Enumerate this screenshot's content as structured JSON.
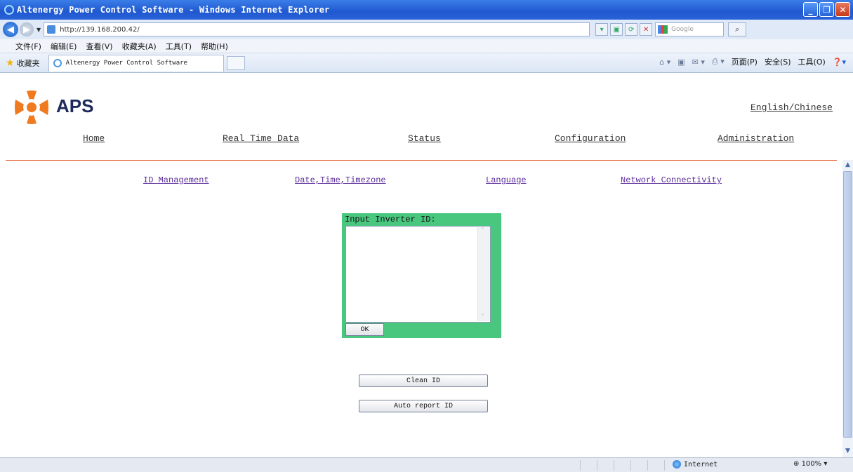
{
  "window": {
    "title": "Altenergy Power Control Software - Windows Internet Explorer"
  },
  "address_bar": {
    "url": "http://139.168.200.42/",
    "search_placeholder": "Google"
  },
  "menu": [
    "文件(F)",
    "编辑(E)",
    "查看(V)",
    "收藏夹(A)",
    "工具(T)",
    "帮助(H)"
  ],
  "favorites": {
    "label": "收藏夹",
    "tab_title": "Altenergy Power Control Software"
  },
  "command_bar": {
    "page": "页面(P)",
    "safety": "安全(S)",
    "tools": "工具(O)"
  },
  "page": {
    "brand": "APS",
    "language_toggle": "English/Chinese",
    "main_nav": [
      "Home",
      "Real Time Data",
      "Status",
      "Configuration",
      "Administration"
    ],
    "sub_nav": [
      "ID Management",
      "Date,Time,Timezone",
      "Language",
      "Network Connectivity"
    ],
    "id_form": {
      "label": "Input Inverter ID:",
      "textarea_value": "",
      "ok_label": "OK"
    },
    "clean_id_label": "Clean ID",
    "auto_report_label": "Auto report ID"
  },
  "status_bar": {
    "zone": "Internet",
    "zoom": "100%"
  },
  "colors": {
    "form_bg": "#49c77f",
    "divider": "#e24b1b",
    "link": "#5a2d9a",
    "logo_orange": "#f07a20",
    "brand_navy": "#1d2a5a"
  }
}
